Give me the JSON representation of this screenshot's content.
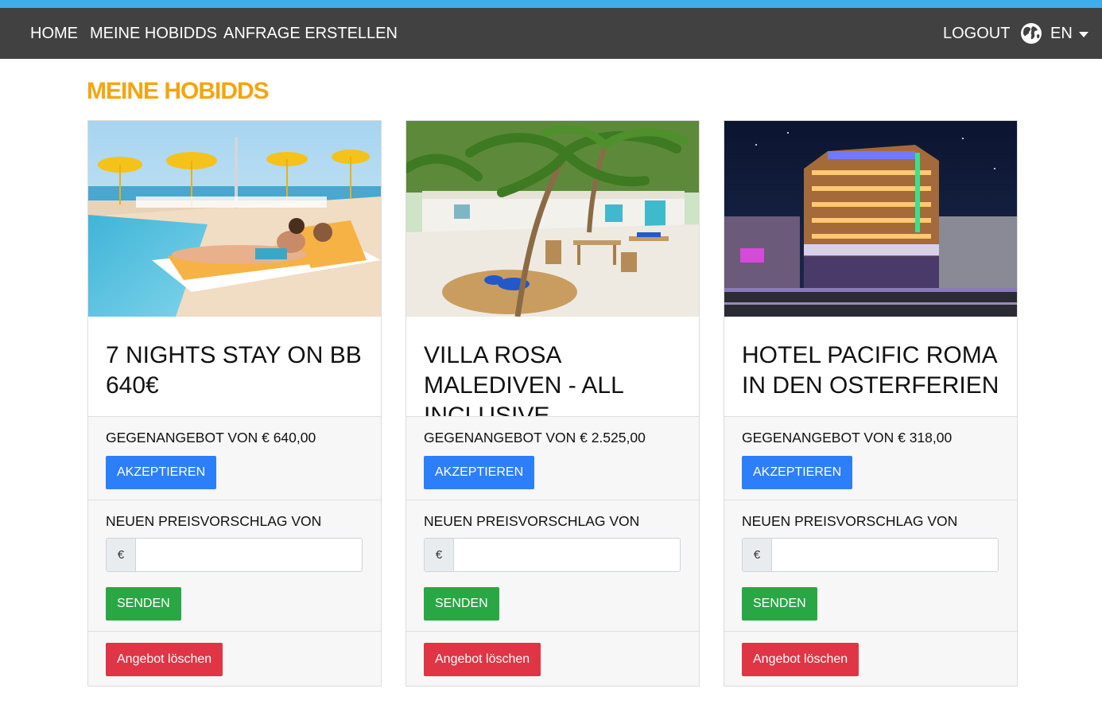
{
  "colors": {
    "accent": "#f5a40f",
    "navbar": "#414141",
    "stripe": "#3daee9",
    "accept": "#2d7ff9",
    "send": "#2aa745",
    "delete": "#df3545"
  },
  "nav": {
    "home": "HOME",
    "my_hobidds": "MEINE HOBIDDS",
    "create_request": "ANFRAGE ERSTELLEN",
    "logout": "LOGOUT",
    "language": "EN",
    "language_icon": "globe-icon"
  },
  "page": {
    "title": "MEINE HOBIDDS"
  },
  "offers": [
    {
      "title": "7 NIGHTS STAY ON BB 640€",
      "counter_offer": "GEGENANGEBOT VON € 640,00",
      "accept_label": "AKZEPTIEREN",
      "propose_label": "NEUEN PREISVORSCHLAG VON",
      "currency": "€",
      "price_value": "",
      "send_label": "SENDEN",
      "delete_label": "Angebot löschen"
    },
    {
      "title": "VILLA ROSA MALEDIVEN - ALL INCLUSIVE",
      "counter_offer": "GEGENANGEBOT VON € 2.525,00",
      "accept_label": "AKZEPTIEREN",
      "propose_label": "NEUEN PREISVORSCHLAG VON",
      "currency": "€",
      "price_value": "",
      "send_label": "SENDEN",
      "delete_label": "Angebot löschen"
    },
    {
      "title": "HOTEL PACIFIC ROMA IN DEN OSTERFERIEN",
      "counter_offer": "GEGENANGEBOT VON € 318,00",
      "accept_label": "AKZEPTIEREN",
      "propose_label": "NEUEN PREISVORSCHLAG VON",
      "currency": "€",
      "price_value": "",
      "send_label": "SENDEN",
      "delete_label": "Angebot löschen"
    }
  ]
}
